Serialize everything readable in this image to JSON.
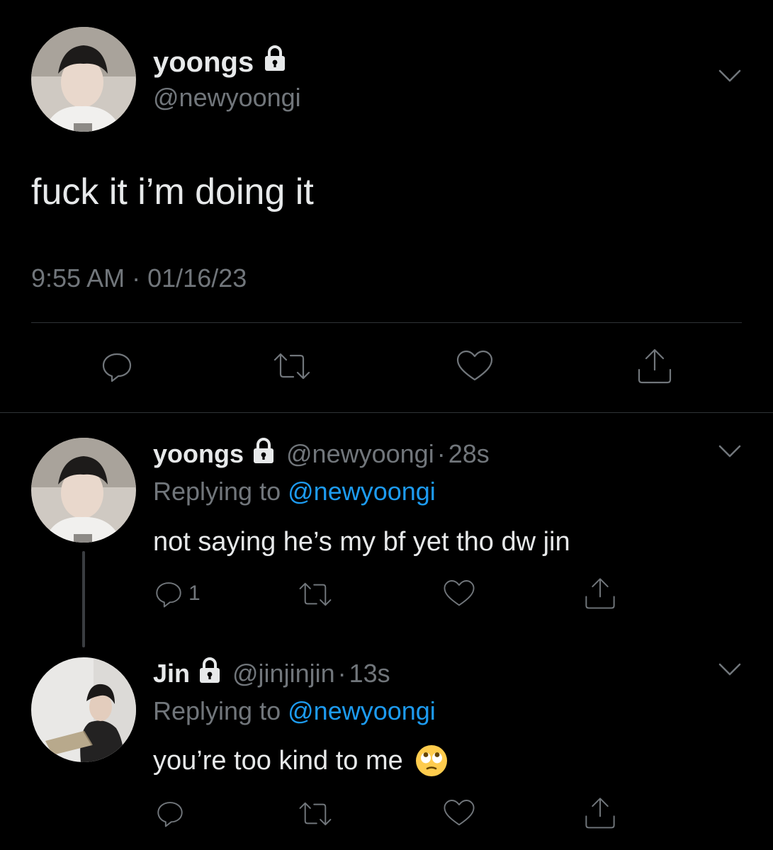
{
  "main_tweet": {
    "display_name": "yoongs",
    "handle": "@newyoongi",
    "text": "fuck it i’m doing it",
    "time": "9:55 AM",
    "separator": "·",
    "date": "01/16/23"
  },
  "replies": [
    {
      "display_name": "yoongs",
      "handle": "@newyoongi",
      "dot": "·",
      "age": "28s",
      "replying_prefix": "Replying to",
      "replying_to": "@newyoongi",
      "text": "not saying he’s my bf yet tho dw jin",
      "reply_count": "1"
    },
    {
      "display_name": "Jin",
      "handle": "@jinjinjin",
      "dot": "·",
      "age": "13s",
      "replying_prefix": "Replying to",
      "replying_to": "@newyoongi",
      "text": "you’re too kind to me",
      "emoji": "🙄"
    }
  ],
  "icons": {
    "protected": "lock-icon",
    "more": "chevron-down-icon",
    "reply": "reply-icon",
    "retweet": "retweet-icon",
    "like": "heart-icon",
    "share": "share-icon"
  },
  "colors": {
    "background": "#000000",
    "text": "#e7e9ea",
    "muted": "#71767b",
    "link": "#1d9bf0"
  }
}
